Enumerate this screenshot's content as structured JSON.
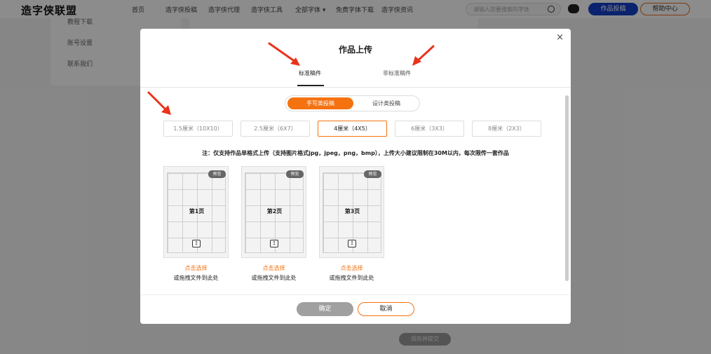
{
  "nav": {
    "logo": "造字侠联盟",
    "links": [
      "首页",
      "造字侠投稿",
      "造字侠代理",
      "造字侠工具",
      "全部字体 ▾",
      "免费字体下载",
      "造字侠资讯"
    ],
    "search_placeholder": "请输入您要搜索的字体",
    "submit_button": "作品投稿",
    "help_button": "帮助中心"
  },
  "background": {
    "sidebar_items": [
      "教程下载",
      "账号设置",
      "联系我们"
    ],
    "save_button": "保存并提交"
  },
  "modal": {
    "title": "作品上传",
    "close": "×",
    "tabs": [
      {
        "label": "标准稿件",
        "active": true
      },
      {
        "label": "非标准稿件",
        "active": false
      }
    ],
    "segment": {
      "options": [
        "手写类投稿",
        "设计类投稿"
      ],
      "selected": "手写类投稿"
    },
    "sizes": [
      {
        "label": "1.5厘米（10X10）",
        "selected": false
      },
      {
        "label": "2.5厘米（6X7）",
        "selected": false
      },
      {
        "label": "4厘米（4X5）",
        "selected": true
      },
      {
        "label": "6厘米（3X3）",
        "selected": false
      },
      {
        "label": "8厘米（2X3）",
        "selected": false
      }
    ],
    "note": "注：仅支持作品单格式上传（支持图片格式jpg，jpeg，png，bmp），上传大小建议限制在30M以内，每次限传一套作品",
    "cards": [
      {
        "page": "第1页",
        "preview": "预览",
        "pick": "点击选择",
        "drag": "或拖拽文件到此处"
      },
      {
        "page": "第2页",
        "preview": "预览",
        "pick": "点击选择",
        "drag": "或拖拽文件到此处"
      },
      {
        "page": "第3页",
        "preview": "预览",
        "pick": "点击选择",
        "drag": "或拖拽文件到此处"
      }
    ],
    "confirm_button": "确定",
    "cancel_button": "取消"
  },
  "colors": {
    "accent": "#f57210",
    "brand_blue": "#1440c8",
    "arrow_red": "#e8341c"
  }
}
